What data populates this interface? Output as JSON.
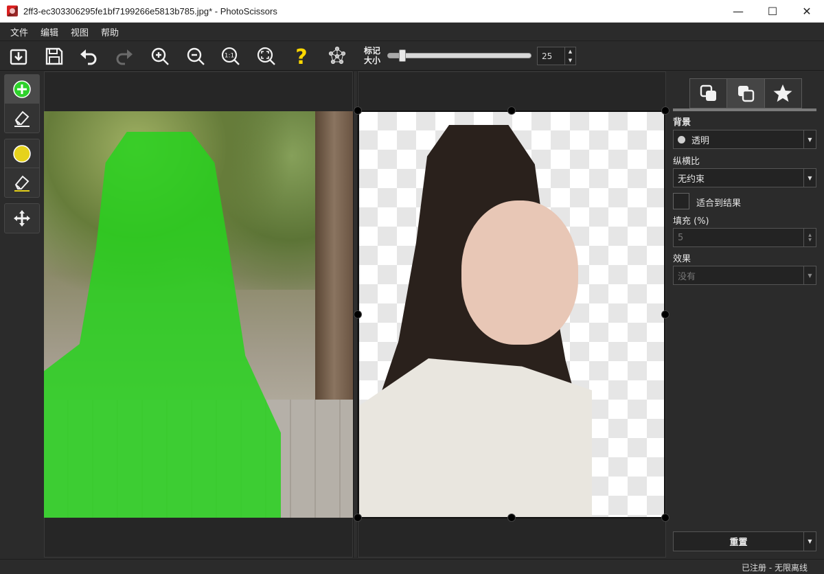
{
  "window": {
    "title": "2ff3-ec303306295fe1bf7199266e5813b785.jpg* - PhotoScissors",
    "minimize": "—",
    "maximize": "☐",
    "close": "✕"
  },
  "menu": [
    "文件",
    "编辑",
    "视图",
    "帮助"
  ],
  "toolbar": {
    "buttons": [
      "open-icon",
      "save-icon",
      "undo-icon",
      "redo-icon",
      "zoom-in-icon",
      "zoom-out-icon",
      "zoom-actual-icon",
      "zoom-fit-icon",
      "help-icon",
      "network-icon"
    ],
    "zoom_actual_label": "1:1",
    "help_glyph": "?",
    "marker_label_line1": "标记",
    "marker_label_line2": "大小",
    "marker_size": "25",
    "marker_size_fraction": 0.1
  },
  "left_tools": [
    "add-foreground-icon",
    "eraser-icon",
    "add-background-icon",
    "eraser-background-icon",
    "move-icon"
  ],
  "colors": {
    "foreground_marker": "#2ed12b",
    "background_marker": "#e6d21c",
    "mask_green": "#28d21e"
  },
  "sidebar": {
    "tabs": [
      "background-tab-icon",
      "foreground-tab-icon",
      "effects-tab-icon"
    ],
    "background_label": "背景",
    "background_value": "透明",
    "aspect_label": "纵横比",
    "aspect_value": "无约束",
    "fit_label": "适合到结果",
    "padding_label": "填充 (%)",
    "padding_value": "5",
    "effect_label": "效果",
    "effect_value": "没有",
    "reset_label": "重置"
  },
  "status": "已注册 - 无限离线"
}
